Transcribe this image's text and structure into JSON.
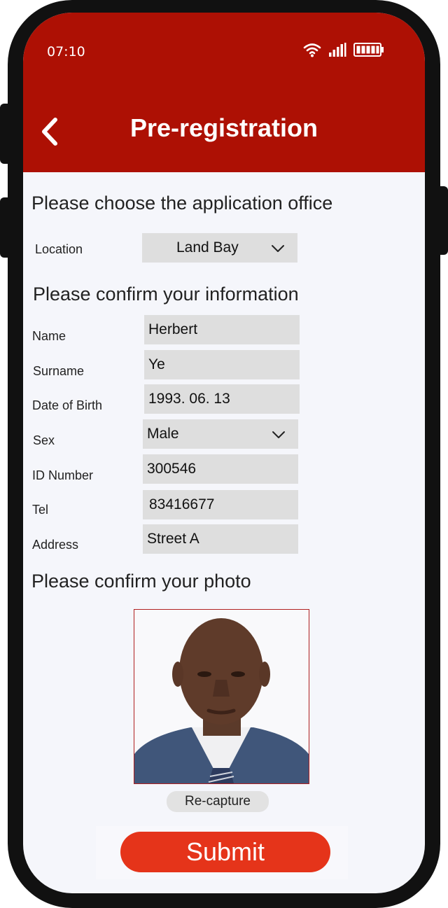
{
  "status_bar": {
    "time": "07:10"
  },
  "header": {
    "title": "Pre-registration"
  },
  "office_section": {
    "title": "Please choose the application office",
    "location_label": "Location",
    "location_value": "Land Bay"
  },
  "info_section": {
    "title": "Please confirm your information",
    "fields": [
      {
        "label": "Name",
        "value": "Herbert"
      },
      {
        "label": "Surname",
        "value": "Ye"
      },
      {
        "label": "Date of Birth",
        "value": "1993. 06. 13"
      },
      {
        "label": "Sex",
        "value": "Male"
      },
      {
        "label": "ID Number",
        "value": "300546"
      },
      {
        "label": "Tel",
        "value": "83416677"
      },
      {
        "label": "Address",
        "value": "Street A"
      }
    ]
  },
  "photo_section": {
    "title": "Please confirm your photo",
    "recapture_label": "Re-capture"
  },
  "actions": {
    "submit_label": "Submit"
  },
  "colors": {
    "header_bg": "#ad1004",
    "submit_bg": "#e5341a",
    "field_bg": "#dedede",
    "screen_bg": "#f5f6fb"
  }
}
